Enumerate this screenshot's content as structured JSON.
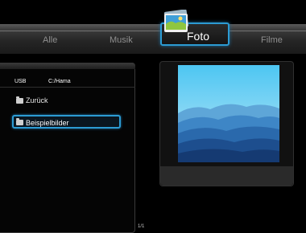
{
  "tabs": {
    "items": [
      "Alle",
      "Musik",
      "Foto",
      "Filme"
    ],
    "active": "Foto"
  },
  "browser": {
    "device": "USB",
    "path": "C:/Hama",
    "back_label": "Zurück",
    "selected_folder": "Beispielbilder",
    "page": "1/1"
  },
  "preview": {
    "caption": ""
  },
  "colors": {
    "accent": "#2c9bd3",
    "background": "#000000"
  },
  "icons": {
    "active_tab": "photo-icon",
    "folders": "folder-icon"
  }
}
